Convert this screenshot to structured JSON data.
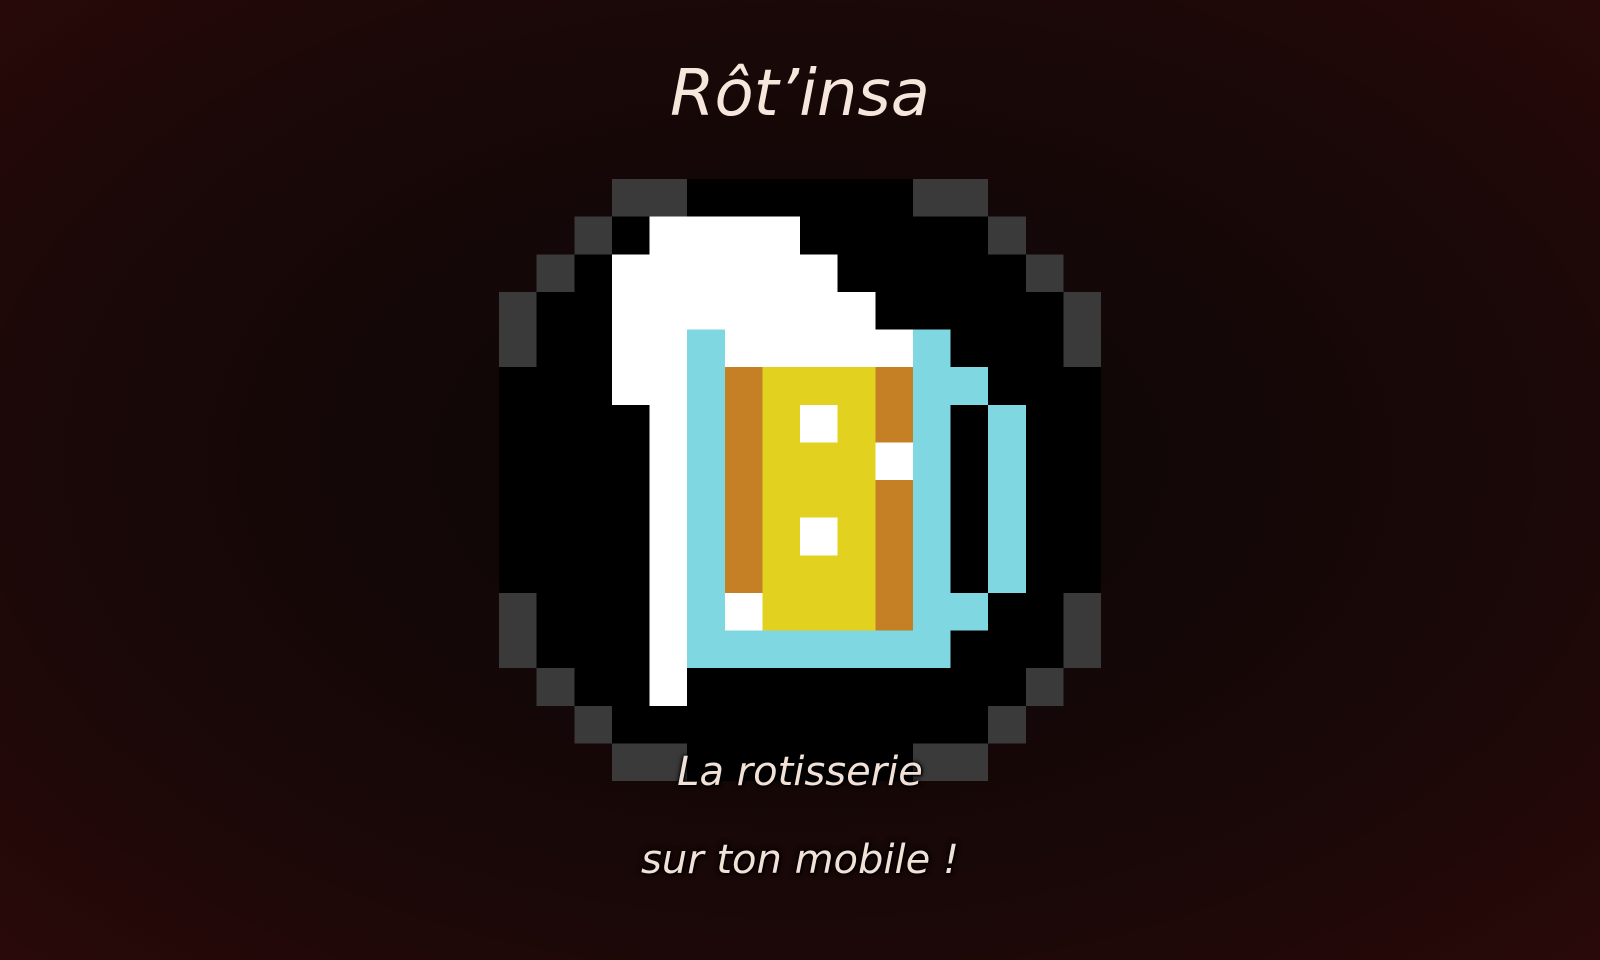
{
  "title": "Rôt’insa",
  "tagline": {
    "line1": "La rotisserie",
    "line2": "sur ton mobile !"
  },
  "logo": {
    "icon": "beer-mug-icon",
    "colors": {
      "frame": "#3a3a3a",
      "background": "#000000",
      "foam": "#ffffff",
      "glass": "#7fd7e2",
      "beer": "#e2d11f",
      "beer_edge": "#c58026",
      "bubble": "#ffffff"
    }
  },
  "colors": {
    "background": "#140707",
    "text": "#f6e6dc"
  }
}
